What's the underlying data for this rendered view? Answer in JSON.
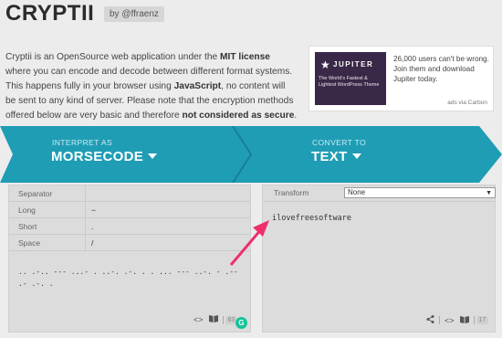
{
  "header": {
    "logo": "CRYPTII",
    "author": "by @ffraenz"
  },
  "intro": {
    "p1": "Cryptii is an OpenSource web application under the ",
    "license": "MIT license",
    "p2": " where you can encode and decode between different format systems. This happens fully in your browser using ",
    "js": "JavaScript",
    "p3": ", no content will be sent to any kind of server. Please note that the encryption methods offered below are very basic and therefore ",
    "warn": "not considered as secure",
    "p4": "."
  },
  "ad": {
    "brand": "JUPITER",
    "tagline": "The World's Fastest & Lightest WordPress Theme",
    "text": "26,000 users can't be wrong. Join them and download Jupiter today.",
    "via": "ads via Carbon",
    "colors": {
      "image_bg": "#3a2848"
    }
  },
  "banner": {
    "interpret_label": "INTERPRET AS",
    "interpret_value": "MORSECODE",
    "convert_label": "CONVERT TO",
    "convert_value": "TEXT",
    "colors": {
      "main": "#1f9db5",
      "dark": "#177f94"
    }
  },
  "left_panel": {
    "rows": [
      {
        "key": "Separator",
        "value": ""
      },
      {
        "key": "Long",
        "value": "−"
      },
      {
        "key": "Short",
        "value": "."
      },
      {
        "key": "Space",
        "value": "/"
      }
    ],
    "morse": ".. .-.. --- ...- . ..-. .-. . . ... --- ..-. - .-- .- .-. .",
    "counter": "63"
  },
  "right_panel": {
    "transform_label": "Transform",
    "transform_value": "None",
    "output": "ilovefreesoftware",
    "counter": "17"
  },
  "icons": {
    "code": "code-icon",
    "book": "book-icon",
    "share": "share-icon",
    "grammarly": "grammarly-icon"
  }
}
